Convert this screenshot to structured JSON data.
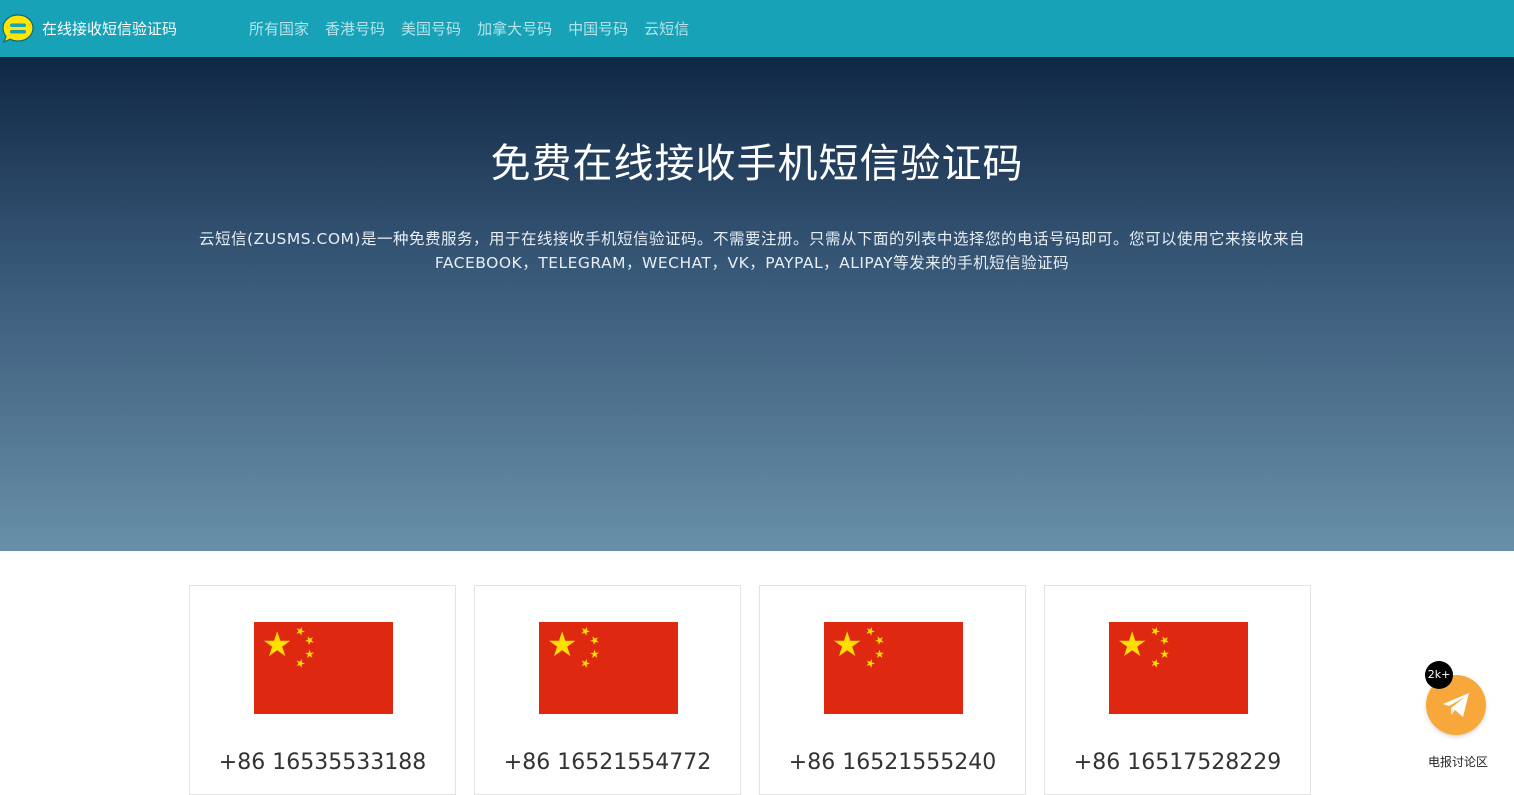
{
  "brand": {
    "title": "在线接收短信验证码",
    "logo_icon": "chat-bubble-icon"
  },
  "nav": {
    "items": [
      {
        "label": "所有国家"
      },
      {
        "label": "香港号码"
      },
      {
        "label": "美国号码"
      },
      {
        "label": "加拿大号码"
      },
      {
        "label": "中国号码"
      },
      {
        "label": "云短信"
      }
    ]
  },
  "hero": {
    "title": "免费在线接收手机短信验证码",
    "description": "云短信(ZUSMS.COM)是一种免费服务，用于在线接收手机短信验证码。不需要注册。只需从下面的列表中选择您的电话号码即可。您可以使用它来接收来自FACEBOOK，TELEGRAM，WECHAT，VK，PAYPAL，ALIPAY等发来的手机短信验证码"
  },
  "numbers": [
    {
      "flag": "china-flag-icon",
      "number": "+86 16535533188"
    },
    {
      "flag": "china-flag-icon",
      "number": "+86 16521554772"
    },
    {
      "flag": "china-flag-icon",
      "number": "+86 16521555240"
    },
    {
      "flag": "china-flag-icon",
      "number": "+86 16517528229"
    }
  ],
  "floating": {
    "badge": "2k+",
    "label": "电报讨论区",
    "icon": "telegram-plane-icon"
  },
  "colors": {
    "navbar": "#18a2b8",
    "nav_link": "#b6e3ea",
    "hero_top": "#0f2844",
    "hero_bottom": "#6890a8",
    "flag_red": "#de2910",
    "flag_yellow": "#ffde00",
    "float_button": "#f8a83a"
  }
}
